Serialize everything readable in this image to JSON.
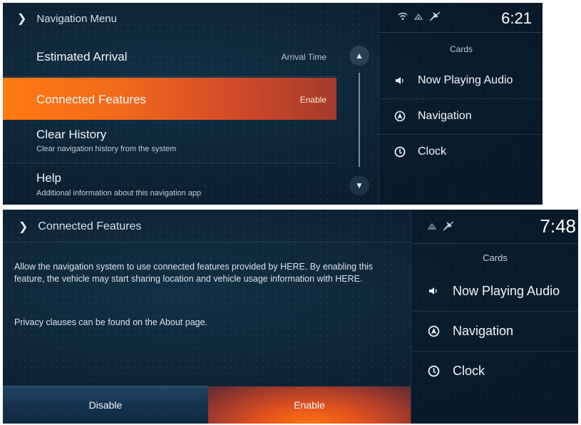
{
  "screen1": {
    "header": {
      "title": "Navigation Menu"
    },
    "menu": [
      {
        "title": "Estimated Arrival",
        "value": "Arrival Time"
      },
      {
        "title": "Connected Features",
        "value": "Enable"
      },
      {
        "title": "Clear History",
        "subtitle": "Clear navigation history from the system"
      },
      {
        "title": "Help",
        "subtitle": "Additional information about this navigation app"
      }
    ],
    "status": {
      "time": "6:21"
    },
    "cards_label": "Cards",
    "cards": [
      {
        "label": "Now Playing Audio",
        "icon": "speaker-icon"
      },
      {
        "label": "Navigation",
        "icon": "navigation-arrow-icon"
      },
      {
        "label": "Clock",
        "icon": "clock-icon"
      }
    ]
  },
  "screen2": {
    "header": {
      "title": "Connected Features"
    },
    "body": {
      "paragraph1": "Allow the navigation system to use connected features provided by HERE. By enabling this feature, the vehicle may start sharing location and vehicle usage information with HERE.",
      "paragraph2": "Privacy clauses can be found on the About page."
    },
    "buttons": {
      "disable": "Disable",
      "enable": "Enable"
    },
    "status": {
      "time": "7:48"
    },
    "cards_label": "Cards",
    "cards": [
      {
        "label": "Now Playing Audio",
        "icon": "speaker-icon"
      },
      {
        "label": "Navigation",
        "icon": "navigation-arrow-icon"
      },
      {
        "label": "Clock",
        "icon": "clock-icon"
      }
    ]
  },
  "colors": {
    "accent_orange": "#f26a1a",
    "background_navy": "#0c2233"
  }
}
